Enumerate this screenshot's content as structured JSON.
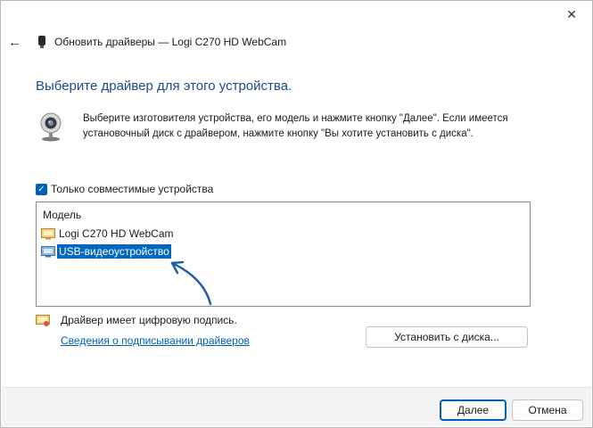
{
  "window": {
    "title": "Обновить драйверы — Logi C270 HD WebCam",
    "close_glyph": "✕",
    "back_glyph": "←"
  },
  "main": {
    "heading": "Выберите драйвер для этого устройства.",
    "description": "Выберите изготовителя устройства, его модель и нажмите кнопку \"Далее\". Если имеется установочный диск с драйвером, нажмите кнопку \"Вы хотите установить с диска\".",
    "checkbox": {
      "label": "Только совместимые устройства",
      "checked": true,
      "glyph": "✓"
    },
    "list": {
      "header": "Модель",
      "items": [
        {
          "label": "Logi C270 HD WebCam",
          "selected": false
        },
        {
          "label": "USB-видеоустройство",
          "selected": true
        }
      ]
    },
    "signed_text": "Драйвер имеет цифровую подпись.",
    "signing_link": "Сведения о подписывании драйверов",
    "install_button": "Установить с диска..."
  },
  "footer": {
    "next_button": "Далее",
    "cancel_button": "Отмена"
  },
  "colors": {
    "accent": "#005fb8",
    "heading": "#1b4a8c",
    "selection": "#0067c0",
    "annotation_arrow": "#1f5fa8"
  }
}
